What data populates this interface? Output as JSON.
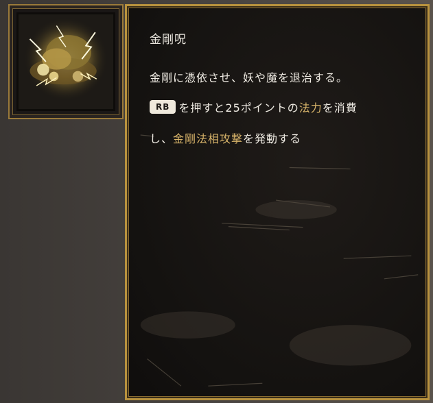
{
  "skill": {
    "icon": "vajra-thunder-icon",
    "title": "金剛呪",
    "description": {
      "line1": "金剛に憑依させ、妖や魔を退治する。",
      "key_badge": "RB",
      "line2_a": "を押すと25ポイントの",
      "line2_highlight": "法力",
      "line2_b": "を消費",
      "line3_a": "し、",
      "line3_highlight": "金剛法相攻撃",
      "line3_b": "を発動する"
    }
  },
  "colors": {
    "frame_gold": "#b8923e",
    "highlight": "#d8b46a",
    "panel_bg": "#141210",
    "text": "#efebe3"
  }
}
